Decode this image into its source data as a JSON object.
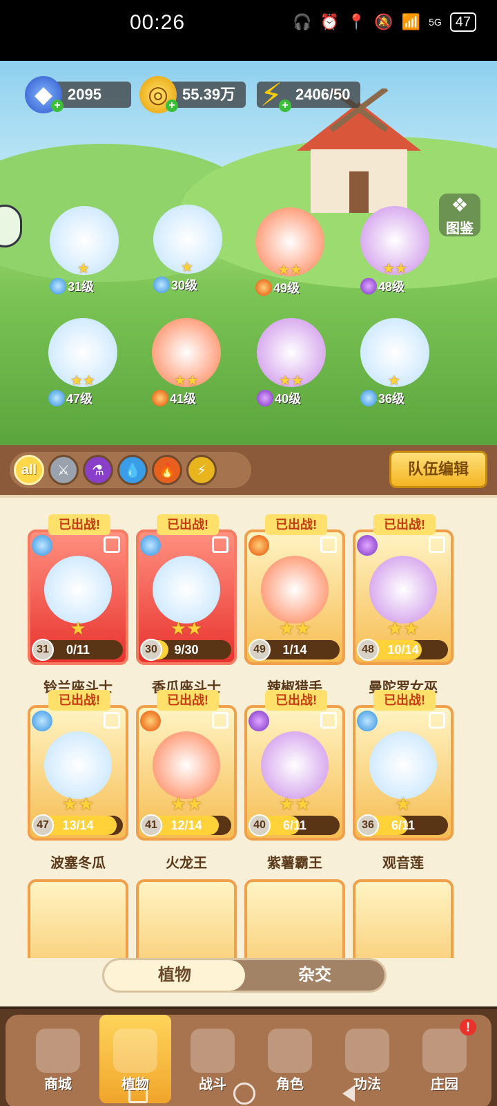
{
  "status_bar": {
    "time": "00:26",
    "network": "5G",
    "battery": "47"
  },
  "resources": {
    "diamonds": "2095",
    "coins": "55.39万",
    "energy": "2406/50"
  },
  "buttons": {
    "dex": "图鉴",
    "team_edit": "队伍编辑"
  },
  "filters": [
    {
      "label": "all"
    },
    {
      "icon": "sword-icon"
    },
    {
      "icon": "potion-icon"
    },
    {
      "icon": "water-drop-icon"
    },
    {
      "icon": "fire-icon"
    },
    {
      "icon": "lightning-icon"
    }
  ],
  "field_heroes": [
    {
      "level": "31级",
      "element": "water",
      "stars": 1
    },
    {
      "level": "30级",
      "element": "water",
      "stars": 1
    },
    {
      "level": "49级",
      "element": "fire",
      "stars": 2
    },
    {
      "level": "48级",
      "element": "poison",
      "stars": 2
    },
    {
      "level": "47级",
      "element": "water",
      "stars": 2
    },
    {
      "level": "41级",
      "element": "fire",
      "stars": 2
    },
    {
      "level": "40级",
      "element": "poison",
      "stars": 2
    },
    {
      "level": "36级",
      "element": "water",
      "stars": 1
    }
  ],
  "card_tag": "已出战!",
  "cards": [
    {
      "name": "铃兰座斗士",
      "level": "31",
      "progress": "0/11",
      "fraction": 0.0,
      "stars": 1,
      "element": "water",
      "style": "red"
    },
    {
      "name": "香瓜座斗士",
      "level": "30",
      "progress": "9/30",
      "fraction": 0.3,
      "stars": 2,
      "element": "water",
      "style": "red"
    },
    {
      "name": "辣椒猎手",
      "level": "49",
      "progress": "1/14",
      "fraction": 0.07,
      "stars": 2,
      "element": "fire",
      "style": "gold"
    },
    {
      "name": "曼陀罗女巫",
      "level": "48",
      "progress": "10/14",
      "fraction": 0.71,
      "stars": 2,
      "element": "poison",
      "style": "gold"
    },
    {
      "name": "波塞冬瓜",
      "level": "47",
      "progress": "13/14",
      "fraction": 0.93,
      "stars": 2,
      "element": "water",
      "style": "gold"
    },
    {
      "name": "火龙王",
      "level": "41",
      "progress": "12/14",
      "fraction": 0.86,
      "stars": 2,
      "element": "fire",
      "style": "gold"
    },
    {
      "name": "紫薯霸王",
      "level": "40",
      "progress": "6/11",
      "fraction": 0.55,
      "stars": 2,
      "element": "poison",
      "style": "gold"
    },
    {
      "name": "观音莲",
      "level": "36",
      "progress": "6/11",
      "fraction": 0.55,
      "stars": 1,
      "element": "water",
      "style": "gold"
    }
  ],
  "tabs": {
    "plants": "植物",
    "hybrid": "杂交"
  },
  "nav": [
    {
      "label": "商城"
    },
    {
      "label": "植物",
      "active": true
    },
    {
      "label": "战斗"
    },
    {
      "label": "角色"
    },
    {
      "label": "功法"
    },
    {
      "label": "庄园",
      "badge": "!"
    }
  ],
  "colors": {
    "accent": "#f4b523",
    "panel": "#f8efd9",
    "nav": "#a87450"
  }
}
